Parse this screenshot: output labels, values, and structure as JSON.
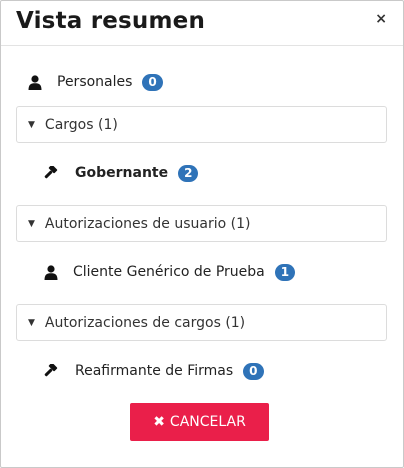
{
  "modal": {
    "title": "Vista resumen",
    "close_label": "×"
  },
  "personales": {
    "label": "Personales",
    "count": "0"
  },
  "sections": [
    {
      "header": "Cargos (1)",
      "item": {
        "label": "Gobernante",
        "count": "2",
        "icon": "gavel-icon"
      }
    },
    {
      "header": "Autorizaciones de usuario (1)",
      "item": {
        "label": "Cliente Genérico de Prueba",
        "count": "1",
        "icon": "user-icon"
      }
    },
    {
      "header": "Autorizaciones de cargos (1)",
      "item": {
        "label": "Reafirmante de Firmas",
        "count": "0",
        "icon": "gavel-icon"
      }
    }
  ],
  "actions": {
    "cancel_label": "CANCELAR"
  },
  "colors": {
    "badge": "#2f73b8",
    "cancel": "#ea1f4a"
  }
}
